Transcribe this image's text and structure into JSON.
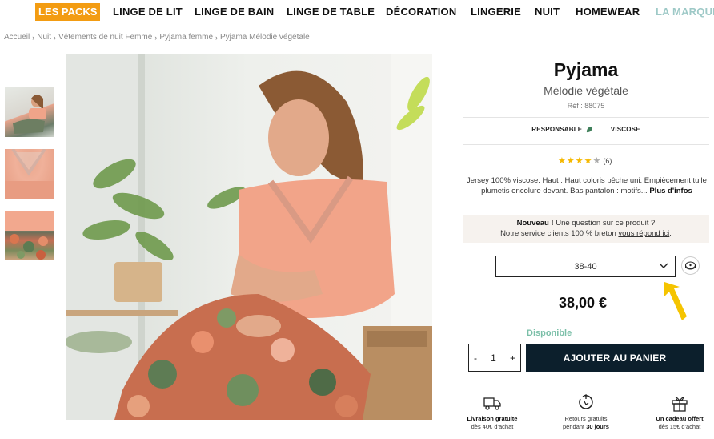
{
  "nav": {
    "packs": "LES PACKS",
    "items": [
      "LINGE DE LIT",
      "LINGE DE BAIN",
      "LINGE DE TABLE",
      "DÉCORATION",
      "LINGERIE",
      "NUIT",
      "HOMEWEAR",
      "LA MARQUE"
    ]
  },
  "breadcrumb": [
    "Accueil",
    "Nuit",
    "Vêtements de nuit Femme",
    "Pyjama femme",
    "Pyjama Mélodie végétale"
  ],
  "product": {
    "title": "Pyjama",
    "subtitle": "Mélodie végétale",
    "ref": "Réf : 88075",
    "tags": [
      "RESPONSABLE",
      "VISCOSE"
    ],
    "rating": {
      "value": 4,
      "max": 5,
      "count": "(6)"
    },
    "description": "Jersey 100% viscose. Haut : Haut coloris pêche uni. Empiècement tulle plumetis encolure devant. Bas pantalon : motifs...",
    "more": "Plus d'infos",
    "notice_bold": "Nouveau !",
    "notice_line1": " Une question sur ce produit ?",
    "notice_line2": "Notre service clients 100 % breton ",
    "notice_link": "vous répond ici",
    "notice_end": ".",
    "size": "38-40",
    "price": "38,00 €",
    "availability": "Disponible",
    "qty": {
      "minus": "-",
      "value": "1",
      "plus": "+"
    },
    "add_to_cart": "AJOUTER AU PANIER"
  },
  "features": [
    {
      "icon": "truck-icon",
      "bold": "Livraison gratuite",
      "line2": "dès 40€ d'achat"
    },
    {
      "icon": "return-icon",
      "line1": "Retours gratuits",
      "line2_pre": "pendant ",
      "line2_bold": "30 jours"
    },
    {
      "icon": "gift-icon",
      "bold": "Un cadeau offert",
      "line2": "dès 15€ d'achat"
    }
  ],
  "colors": {
    "packs": "#f39c12",
    "cart_button": "#0c1f2c",
    "available": "#7bbfa8",
    "star": "#f5b800",
    "arrow": "#f5c400"
  }
}
